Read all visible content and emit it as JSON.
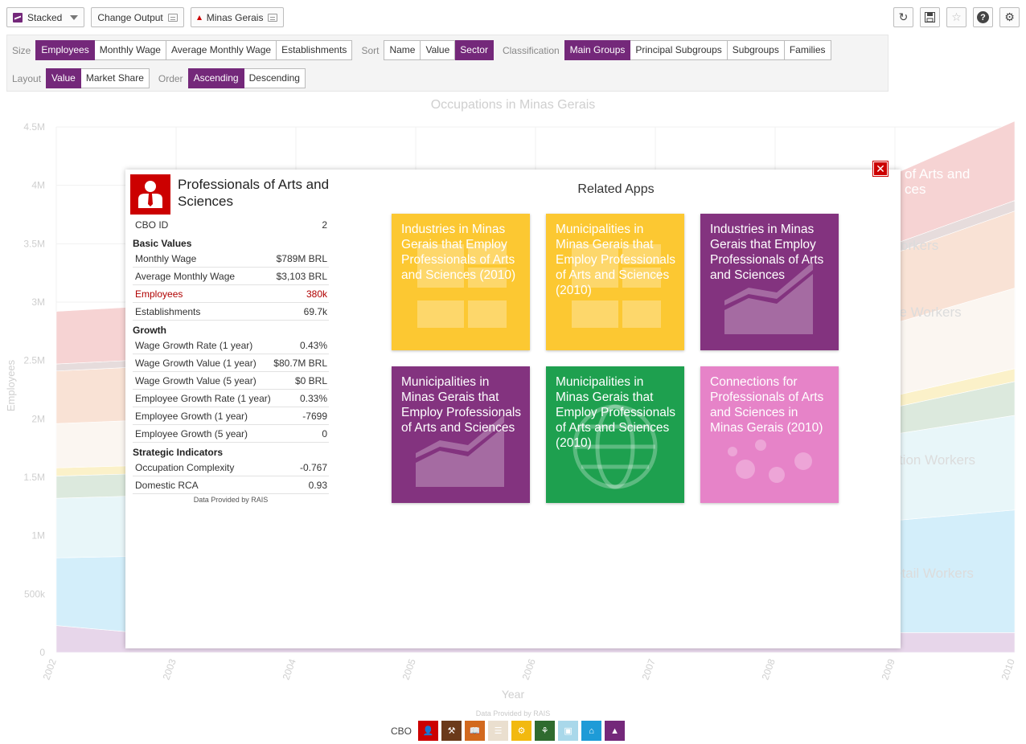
{
  "toolbar": {
    "viz_select": "Stacked",
    "change_output": "Change Output",
    "location": "Minas Gerais",
    "tools": [
      "refresh-icon",
      "save-icon",
      "star-icon",
      "help-icon",
      "settings-icon"
    ]
  },
  "controls": {
    "size": {
      "label": "Size",
      "options": [
        "Employees",
        "Monthly Wage",
        "Average Monthly Wage",
        "Establishments"
      ],
      "active": "Employees"
    },
    "sort": {
      "label": "Sort",
      "options": [
        "Name",
        "Value",
        "Sector"
      ],
      "active": "Sector"
    },
    "classification": {
      "label": "Classification",
      "options": [
        "Main Groups",
        "Principal Subgroups",
        "Subgroups",
        "Families"
      ],
      "active": "Main Groups"
    },
    "layout": {
      "label": "Layout",
      "options": [
        "Value",
        "Market Share"
      ],
      "active": "Value"
    },
    "order": {
      "label": "Order",
      "options": [
        "Ascending",
        "Descending"
      ],
      "active": "Ascending"
    }
  },
  "chart_data": {
    "type": "area",
    "title": "Occupations in Minas Gerais",
    "xlabel": "Year",
    "ylabel": "Employees",
    "x": [
      "2002",
      "2003",
      "2004",
      "2005",
      "2006",
      "2007",
      "2008",
      "2009",
      "2010"
    ],
    "y_ticks": [
      "0",
      "500k",
      "1M",
      "1.5M",
      "2M",
      "2.5M",
      "3M",
      "3.5M",
      "4M",
      "4.5M"
    ],
    "ylim": [
      0,
      4500000
    ],
    "grid": true,
    "series_colors": [
      "#e7d6ea",
      "#d3eefa",
      "#e8f6f9",
      "#dce9dd",
      "#fbf1c9",
      "#fbf6f1",
      "#f9e2d5",
      "#e6dcdc",
      "#f6d3d3"
    ],
    "visible_labels": [
      "of Arts and",
      "ces",
      "orkers",
      "ve Workers",
      "uction Workers",
      "etail Workers"
    ],
    "credit": "Data Provided by RAIS"
  },
  "legend": {
    "label": "CBO",
    "items": [
      {
        "icon": "person-icon",
        "color": "#cc0000"
      },
      {
        "icon": "wrench-icon",
        "color": "#6b3a1a"
      },
      {
        "icon": "book-icon",
        "color": "#d2691e"
      },
      {
        "icon": "clipboard-icon",
        "color": "#eadfcf"
      },
      {
        "icon": "gears-icon",
        "color": "#f2b90f"
      },
      {
        "icon": "wheat-icon",
        "color": "#2f6b2f"
      },
      {
        "icon": "box-icon",
        "color": "#a9d8ea"
      },
      {
        "icon": "store-icon",
        "color": "#1e9bd7"
      },
      {
        "icon": "desk-icon",
        "color": "#74287a"
      }
    ]
  },
  "modal": {
    "title": "Professionals of Arts and Sciences",
    "cbo_id": {
      "label": "CBO ID",
      "value": "2"
    },
    "sections": [
      {
        "heading": "Basic Values",
        "rows": [
          {
            "label": "Monthly Wage",
            "value": "$789M BRL"
          },
          {
            "label": "Average Monthly Wage",
            "value": "$3,103 BRL"
          },
          {
            "label": "Employees",
            "value": "380k",
            "highlight": true
          },
          {
            "label": "Establishments",
            "value": "69.7k"
          }
        ]
      },
      {
        "heading": "Growth",
        "rows": [
          {
            "label": "Wage Growth Rate (1 year)",
            "value": "0.43%"
          },
          {
            "label": "Wage Growth Value (1 year)",
            "value": "$80.7M BRL"
          },
          {
            "label": "Wage Growth Value (5 year)",
            "value": "$0 BRL"
          },
          {
            "label": "Employee Growth Rate (1 year)",
            "value": "0.33%"
          },
          {
            "label": "Employee Growth (1 year)",
            "value": "-7699"
          },
          {
            "label": "Employee Growth (5 year)",
            "value": "0"
          }
        ]
      },
      {
        "heading": "Strategic Indicators",
        "rows": [
          {
            "label": "Occupation Complexity",
            "value": "-0.767"
          },
          {
            "label": "Domestic RCA",
            "value": "0.93"
          }
        ]
      }
    ],
    "credit": "Data Provided by RAIS",
    "related_title": "Related Apps",
    "apps": [
      {
        "text": "Industries in Minas Gerais that Employ Professionals of Arts and Sciences (2010)",
        "color": "#fcc832",
        "icon": "treemap-icon"
      },
      {
        "text": "Municipalities in Minas Gerais that Employ Professionals of Arts and Sciences (2010)",
        "color": "#fcc832",
        "icon": "treemap-icon"
      },
      {
        "text": "Industries in Minas Gerais that Employ Professionals of Arts and Sciences",
        "color": "#83337f",
        "icon": "stacked-icon"
      },
      {
        "text": "Municipalities in Minas Gerais that Employ Professionals of Arts and Sciences",
        "color": "#83337f",
        "icon": "stacked-icon"
      },
      {
        "text": "Municipalities in Minas Gerais that Employ Professionals of Arts and Sciences (2010)",
        "color": "#1ea04f",
        "icon": "globe-icon"
      },
      {
        "text": "Connections for Professionals of Arts and Sciences in Minas Gerais (2010)",
        "color": "#e683c8",
        "icon": "network-icon"
      }
    ]
  }
}
